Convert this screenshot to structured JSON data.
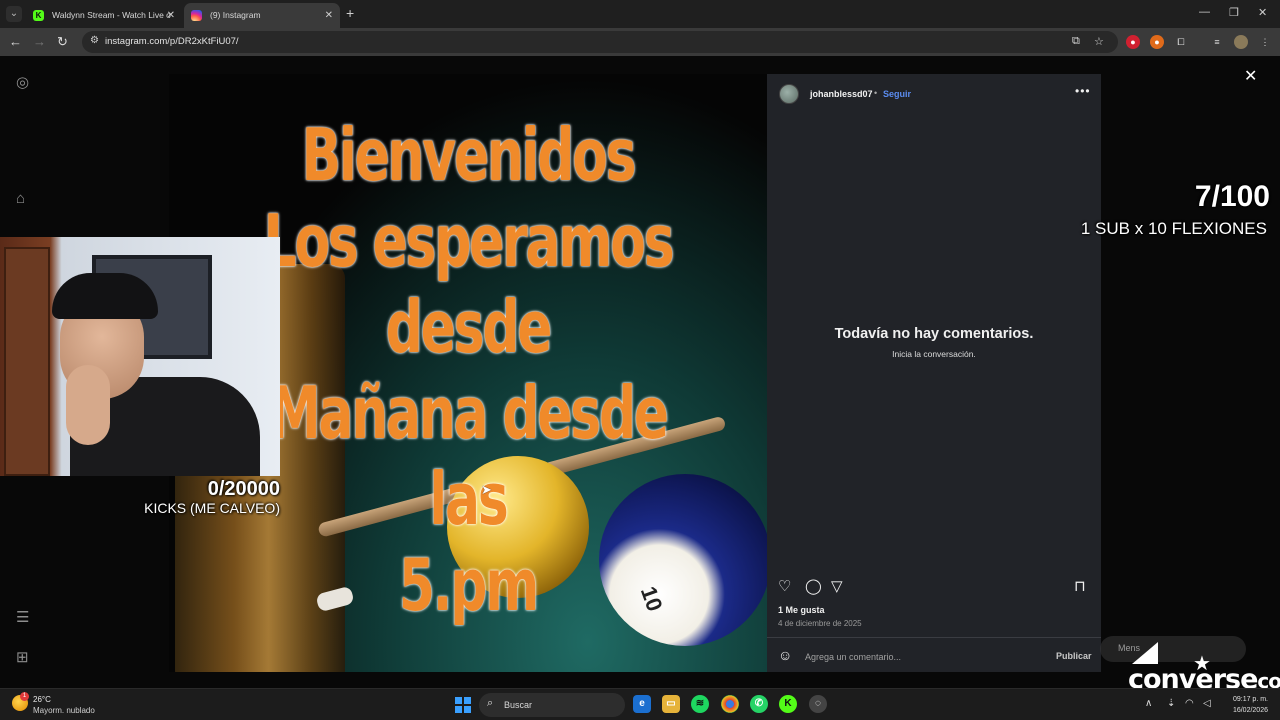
{
  "browser": {
    "tabs": [
      {
        "title": "Waldynn Stream - Watch Live o",
        "favicon": "K",
        "active": false
      },
      {
        "title": "(9) Instagram",
        "active": true
      }
    ],
    "url": "instagram.com/p/DR2xKtFiU07/"
  },
  "post": {
    "headline": [
      "Bienvenidos",
      "Los esperamos",
      "desde",
      "Mañana desde las",
      "5.pm"
    ],
    "ball_number": "10",
    "author": "johanblessd07",
    "separator": "•",
    "follow_label": "Seguir",
    "no_comments_title": "Todavía no hay comentarios.",
    "no_comments_subtitle": "Inicia la conversación.",
    "likes": "1 Me gusta",
    "date": "4 de diciembre de 2025",
    "comment_placeholder": "Agrega un comentario...",
    "publish_label": "Publicar"
  },
  "overlay": {
    "kicks_goal": "0/20000",
    "kicks_label": "KICKS (ME CALVEO)",
    "subs_goal": "7/100",
    "subs_label": "1 SUB x 10 FLEXIONES",
    "brand": "converse",
    "brand_suffix": "col",
    "messages_ghost": "Mens"
  },
  "taskbar": {
    "temperature": "26°C",
    "weather": "Mayorm. nublado",
    "weather_badge": "1",
    "search_label": "Buscar",
    "time": "09:17 p. m.",
    "date": "16/02/2026"
  },
  "colors": {
    "headline": "#f08a2a",
    "follow": "#5b8cf0",
    "panel": "#212328",
    "kick_green": "#53fc18"
  }
}
